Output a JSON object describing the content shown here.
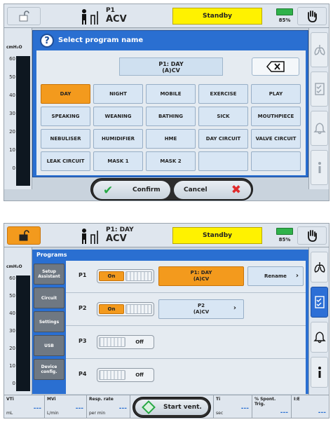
{
  "screen1": {
    "header": {
      "program_code": "P1",
      "mode": "ACV",
      "status": "Standby",
      "battery_pct": "85%"
    },
    "gauge": {
      "unit": "cmH₂O",
      "ticks": [
        "60",
        "50",
        "40",
        "30",
        "20",
        "10",
        "0"
      ]
    },
    "dialog": {
      "title": "Select program name",
      "name_line1": "P1: DAY",
      "name_line2": "(A)CV",
      "keys": [
        {
          "label": "DAY",
          "selected": true
        },
        {
          "label": "NIGHT"
        },
        {
          "label": "MOBILE"
        },
        {
          "label": "EXERCISE"
        },
        {
          "label": "PLAY"
        },
        {
          "label": "SPEAKING"
        },
        {
          "label": "WEANING"
        },
        {
          "label": "BATHING"
        },
        {
          "label": "SICK"
        },
        {
          "label": "MOUTHPIECE"
        },
        {
          "label": "NEBULISER"
        },
        {
          "label": "HUMIDIFIER"
        },
        {
          "label": "HME"
        },
        {
          "label": "DAY CIRCUIT"
        },
        {
          "label": "VALVE CIRCUIT"
        },
        {
          "label": "LEAK CIRCUIT"
        },
        {
          "label": "MASK 1"
        },
        {
          "label": "MASK 2"
        },
        {
          "label": ""
        },
        {
          "label": ""
        }
      ]
    },
    "confirm_label": "Confirm",
    "cancel_label": "Cancel"
  },
  "screen2": {
    "header": {
      "program_code": "P1: DAY",
      "mode": "ACV",
      "status": "Standby",
      "battery_pct": "85%"
    },
    "gauge": {
      "unit": "cmH₂O",
      "ticks": [
        "60",
        "50",
        "40",
        "30",
        "20",
        "10",
        "0"
      ]
    },
    "title": "Programs",
    "nav": [
      "Setup Assistant",
      "Circuit",
      "Settings",
      "USB",
      "Device config."
    ],
    "programs": [
      {
        "label": "P1",
        "state": "On",
        "name_line1": "P1: DAY",
        "name_line2": "(A)CV",
        "rename": "Rename"
      },
      {
        "label": "P2",
        "state": "On",
        "name_line1": "P2",
        "name_line2": "(A)CV"
      },
      {
        "label": "P3",
        "state": "Off"
      },
      {
        "label": "P4",
        "state": "Off"
      }
    ],
    "status": [
      {
        "label": "VTi",
        "unit": "mL",
        "value": "---"
      },
      {
        "label": "MVi",
        "unit": "L/min",
        "value": "---"
      },
      {
        "label": "Resp. rate",
        "unit": "per min",
        "value": "---"
      },
      {
        "label": "Ti",
        "unit": "sec",
        "value": "---"
      },
      {
        "label": "% Spont. Trig.",
        "unit": "",
        "value": "---"
      },
      {
        "label": "I:E",
        "unit": "",
        "value": "---"
      }
    ],
    "start_label": "Start vent."
  }
}
